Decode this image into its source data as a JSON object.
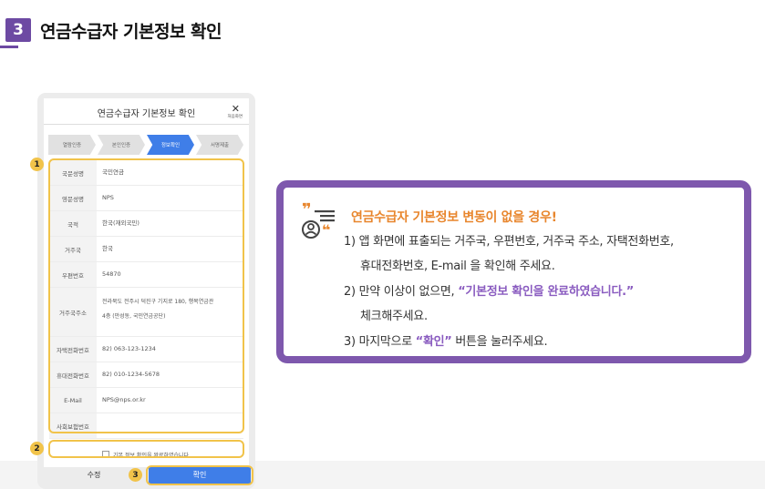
{
  "section": {
    "number": "3",
    "title": "연금수급자 기본정보 확인",
    "accent_color": "#6d4aa3"
  },
  "screen": {
    "title": "연금수급자 기본정보 확인",
    "close_icon": "close-icon",
    "close_label": "처음화면",
    "steps": [
      "열람인증",
      "본인인증",
      "정보확인",
      "서명제출"
    ],
    "active_step": "정보확인",
    "fields": [
      {
        "label": "국문성명",
        "value": "국민연금"
      },
      {
        "label": "영문성명",
        "value": "NPS"
      },
      {
        "label": "국적",
        "value": "한국(재외국민)"
      },
      {
        "label": "거주국",
        "value": "한국"
      },
      {
        "label": "우편번호",
        "value": "54870"
      },
      {
        "label": "거주국주소",
        "value": "전라북도 전주시 덕진구 기지로 180, 행복연금관",
        "value2": "4층 (만성동, 국민연금공단)"
      },
      {
        "label": "자택전화번호",
        "value": "82) 063-123-1234"
      },
      {
        "label": "휴대전화번호",
        "value": "82) 010-1234-5678"
      },
      {
        "label": "E-Mail",
        "value": "NPS@nps.or.kr"
      },
      {
        "label": "사회보험번호",
        "value": ""
      }
    ],
    "agree_text": "기본 정보 확인을 완료하였습니다.",
    "edit_button": "수정",
    "confirm_button": "확인",
    "button_color": "#3f7ee8"
  },
  "markers": [
    "1",
    "2",
    "3"
  ],
  "callout": {
    "heading": "연금수급자 기본정보 변동이 없을 경우!",
    "line1": "1) 앱 화면에 표출되는 거주국, 우편번호, 거주국 주소, 자택전화번호,",
    "line2": "휴대전화번호, E-mail 을 확인해 주세요.",
    "line3_pre": "2) 만약 이상이 없으면, ",
    "line3_hl": "“기본정보 확인을 완료하였습니다.”",
    "line4": "체크해주세요.",
    "line5_pre": "3) 마지막으로 ",
    "line5_hl": "“확인”",
    "line5_post": " 버튼을 눌러주세요.",
    "icon": "speech-quote-icon",
    "border_color": "#7e58ad",
    "heading_color": "#e8862d"
  }
}
